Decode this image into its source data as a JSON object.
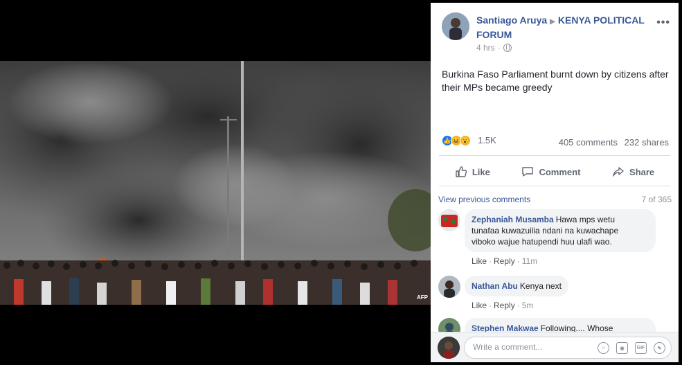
{
  "post": {
    "author": "Santiago Aruya",
    "group": "KENYA POLITICAL FORUM",
    "time": "4 hrs",
    "text": "Burkina Faso Parliament burnt down by citizens after their MPs became greedy",
    "reactions_count": "1.5K",
    "comments_count": "405 comments",
    "shares_count": "232 shares",
    "photo_credit": "AFP"
  },
  "actions": {
    "like": "Like",
    "comment": "Comment",
    "share": "Share"
  },
  "comments": {
    "view_previous": "View previous comments",
    "count_of": "7 of 365",
    "items": [
      {
        "name": "Zephaniah Musamba",
        "text_line1": "Hawa mps wetu",
        "text_line2": "tunafaa kuwazuilia ndani na kuwachape",
        "text_line3": "viboko wajue hatupendi huu ulafi wao.",
        "like": "Like",
        "reply": "Reply",
        "time": "11m"
      },
      {
        "name": "Nathan Abu",
        "text": "Kenya next",
        "like": "Like",
        "reply": "Reply",
        "time": "5m"
      },
      {
        "name": "Stephen Makwae",
        "text": "Following.... Whose"
      }
    ]
  },
  "composer": {
    "placeholder": "Write a comment..."
  },
  "colors": {
    "link_blue": "#385898",
    "muted": "#90949c",
    "like_blue": "#1877f2"
  },
  "icons": [
    "globe-icon",
    "more-icon",
    "like-icon",
    "haha-icon",
    "wow-icon",
    "thumbs-up-icon",
    "comment-icon",
    "share-icon",
    "emoji-icon",
    "camera-icon",
    "gif-icon",
    "sticker-icon"
  ]
}
